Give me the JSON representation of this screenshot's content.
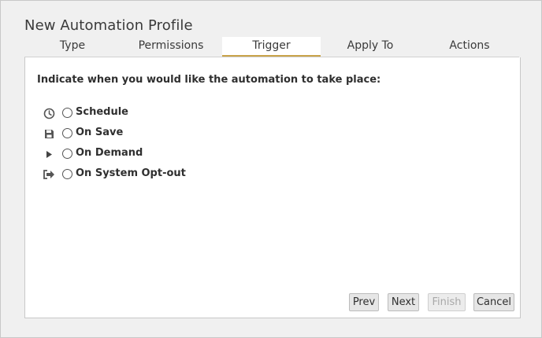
{
  "dialog": {
    "title": "New Automation Profile"
  },
  "tabs": [
    {
      "label": "Type"
    },
    {
      "label": "Permissions"
    },
    {
      "label": "Trigger",
      "active": true
    },
    {
      "label": "Apply To"
    },
    {
      "label": "Actions"
    }
  ],
  "content": {
    "prompt": "Indicate when you would like the automation to take place:",
    "options": [
      {
        "icon": "clock-icon",
        "label": "Schedule"
      },
      {
        "icon": "floppy-disk-icon",
        "label": "On Save"
      },
      {
        "icon": "play-triangle-icon",
        "label": "On Demand"
      },
      {
        "icon": "sign-out-arrow-icon",
        "label": "On System Opt-out"
      }
    ]
  },
  "buttons": {
    "prev": "Prev",
    "next": "Next",
    "finish": "Finish",
    "cancel": "Cancel"
  },
  "colors": {
    "active_tab_underline": "#c9a34a",
    "panel_background": "#ffffff",
    "dialog_background": "#f0f0f0"
  }
}
